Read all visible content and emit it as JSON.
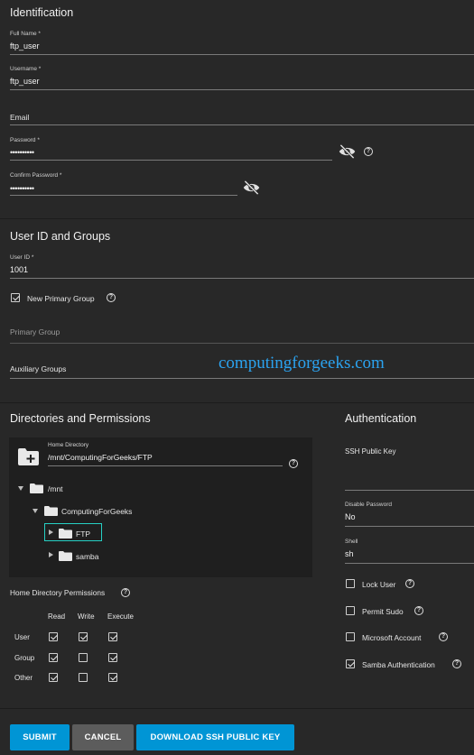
{
  "identification": {
    "heading": "Identification",
    "full_name_label": "Full Name *",
    "full_name_value": "ftp_user",
    "username_label": "Username *",
    "username_value": "ftp_user",
    "email_placeholder": "Email",
    "password_label": "Password *",
    "password_value": "••••••••••",
    "confirm_label": "Confirm Password *",
    "confirm_value": "••••••••••",
    "eye_icon": "eye-off-icon",
    "help_icon": "help-circle-icon"
  },
  "user_id_groups": {
    "heading": "User ID and Groups",
    "user_id_label": "User ID *",
    "user_id_value": "1001",
    "new_primary_group_label": "New Primary Group",
    "new_primary_group_checked": true,
    "primary_group_placeholder": "Primary Group",
    "auxiliary_groups_placeholder": "Auxiliary Groups"
  },
  "watermark": "computingforgeeks.com",
  "directories": {
    "heading": "Directories and Permissions",
    "home_dir_label": "Home Directory",
    "home_dir_value": "/mnt/ComputingForGeeks/FTP",
    "tree": [
      {
        "label": "/mnt"
      },
      {
        "label": "ComputingForGeeks"
      },
      {
        "label": "FTP",
        "selected": true
      },
      {
        "label": "samba"
      }
    ],
    "permissions_label": "Home Directory Permissions",
    "columns": [
      "Read",
      "Write",
      "Execute"
    ],
    "rows": [
      {
        "label": "User",
        "values": [
          true,
          true,
          true
        ]
      },
      {
        "label": "Group",
        "values": [
          true,
          false,
          true
        ]
      },
      {
        "label": "Other",
        "values": [
          true,
          false,
          true
        ]
      }
    ]
  },
  "authentication": {
    "heading": "Authentication",
    "ssh_key_placeholder": "SSH Public Key",
    "disable_password_label": "Disable Password",
    "disable_password_value": "No",
    "shell_label": "Shell",
    "shell_value": "sh",
    "lock_user_label": "Lock User",
    "lock_user_checked": false,
    "permit_sudo_label": "Permit Sudo",
    "permit_sudo_checked": false,
    "microsoft_account_label": "Microsoft Account",
    "microsoft_account_checked": false,
    "samba_auth_label": "Samba Authentication",
    "samba_auth_checked": true
  },
  "actions": {
    "submit_label": "SUBMIT",
    "cancel_label": "CANCEL",
    "download_label": "DOWNLOAD SSH PUBLIC KEY",
    "primary_color": "#0095d5",
    "cancel_color": "#5c5c5c"
  },
  "colors": {
    "background": "#282828",
    "panel": "#1f1f1f",
    "accent": "#0095d5",
    "selection_border": "#26d0c4",
    "watermark": "#2ba3f0"
  }
}
